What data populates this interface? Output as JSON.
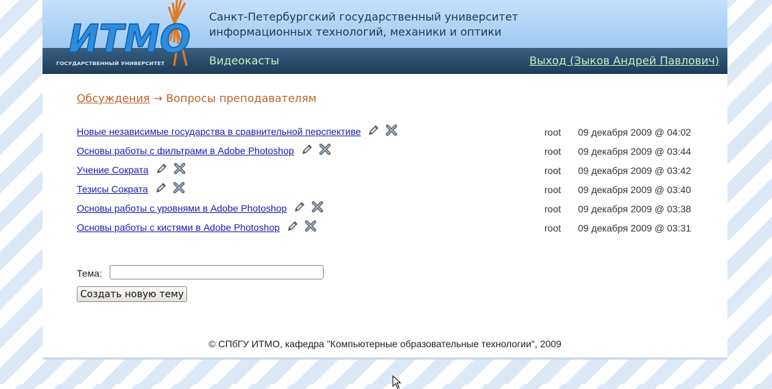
{
  "header": {
    "logo_text": "ИТМО",
    "logo_subtext": "ГОСУДАРСТВЕННЫЙ УНИВЕРСИТЕТ",
    "university_line1": "Санкт-Петербургский государственный университет",
    "university_line2": "информационных технологий, механики и оптики",
    "nav_videocasts": "Видеокасты",
    "logout": "Выход (Зыков Андрей Павлович)"
  },
  "breadcrumb": {
    "parent": "Обсуждения",
    "separator": "→",
    "current": "Вопросы преподавателям"
  },
  "topics": [
    {
      "title": "Новые независимые государства в сравнительной перспективе",
      "author": "root",
      "date": "09 декабря 2009 @ 04:02"
    },
    {
      "title": "Основы работы с фильтрами в Adobe Photoshop",
      "author": "root",
      "date": "09 декабря 2009 @ 03:44"
    },
    {
      "title": "Учение Сократа",
      "author": "root",
      "date": "09 декабря 2009 @ 03:42"
    },
    {
      "title": "Тезисы Сократа",
      "author": "root",
      "date": "09 декабря 2009 @ 03:40"
    },
    {
      "title": "Основы работы с уровнями в Adobe Photoshop",
      "author": "root",
      "date": "09 декабря 2009 @ 03:38"
    },
    {
      "title": "Основы работы с кистями в Adobe Photoshop",
      "author": "root",
      "date": "09 декабря 2009 @ 03:31"
    }
  ],
  "form": {
    "topic_label": "Тема:",
    "topic_value": "",
    "create_button": "Создать новую тему"
  },
  "footer": {
    "text": "© СПбГУ ИТМО, кафедра \"Компьютерные образовательные технологии\", 2009"
  },
  "colors": {
    "link": "#1a1ab0",
    "accent_orange": "#c0622e",
    "header_bar": "#1d3c5a",
    "nav_text": "#c8f0c0"
  },
  "icons": [
    "edit-pencil-icon",
    "delete-x-icon"
  ]
}
